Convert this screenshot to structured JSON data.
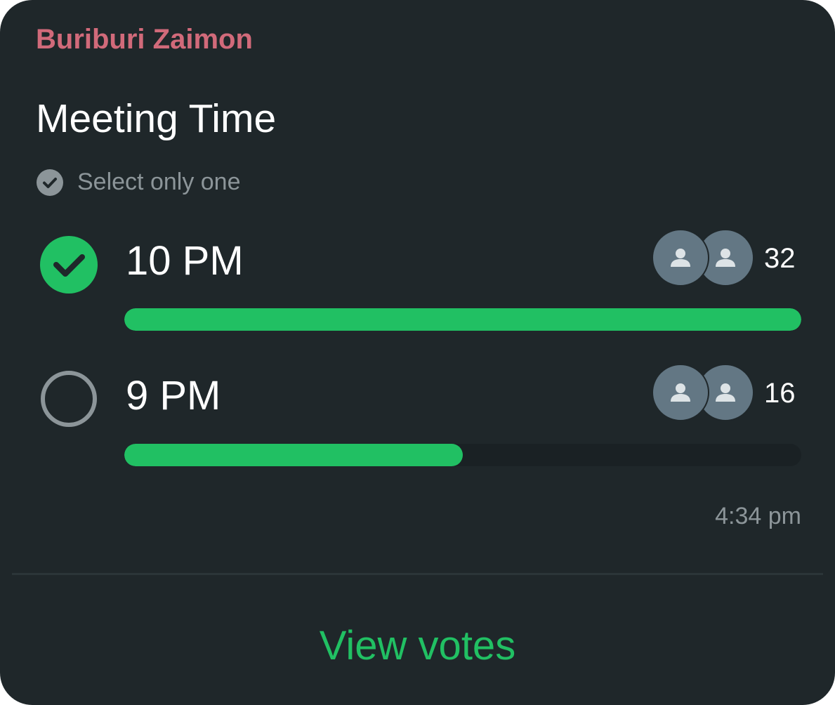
{
  "poll": {
    "sender": "Buriburi Zaimon",
    "question": "Meeting Time",
    "hint": "Select only one",
    "options": [
      {
        "label": "10 PM",
        "votes": "32",
        "selected": true,
        "fraction": 1.0
      },
      {
        "label": "9 PM",
        "votes": "16",
        "selected": false,
        "fraction": 0.5
      }
    ],
    "timestamp": "4:34 pm",
    "view_votes_label": "View votes"
  },
  "colors": {
    "background": "#1f272a",
    "sender": "#d16a7a",
    "accent": "#21c063",
    "muted": "#8c9599",
    "avatar": "#637784"
  },
  "icons": {
    "hint": "check-circle-icon",
    "selected": "checked-radio-icon",
    "unselected": "empty-radio-icon",
    "avatar": "person-icon"
  }
}
